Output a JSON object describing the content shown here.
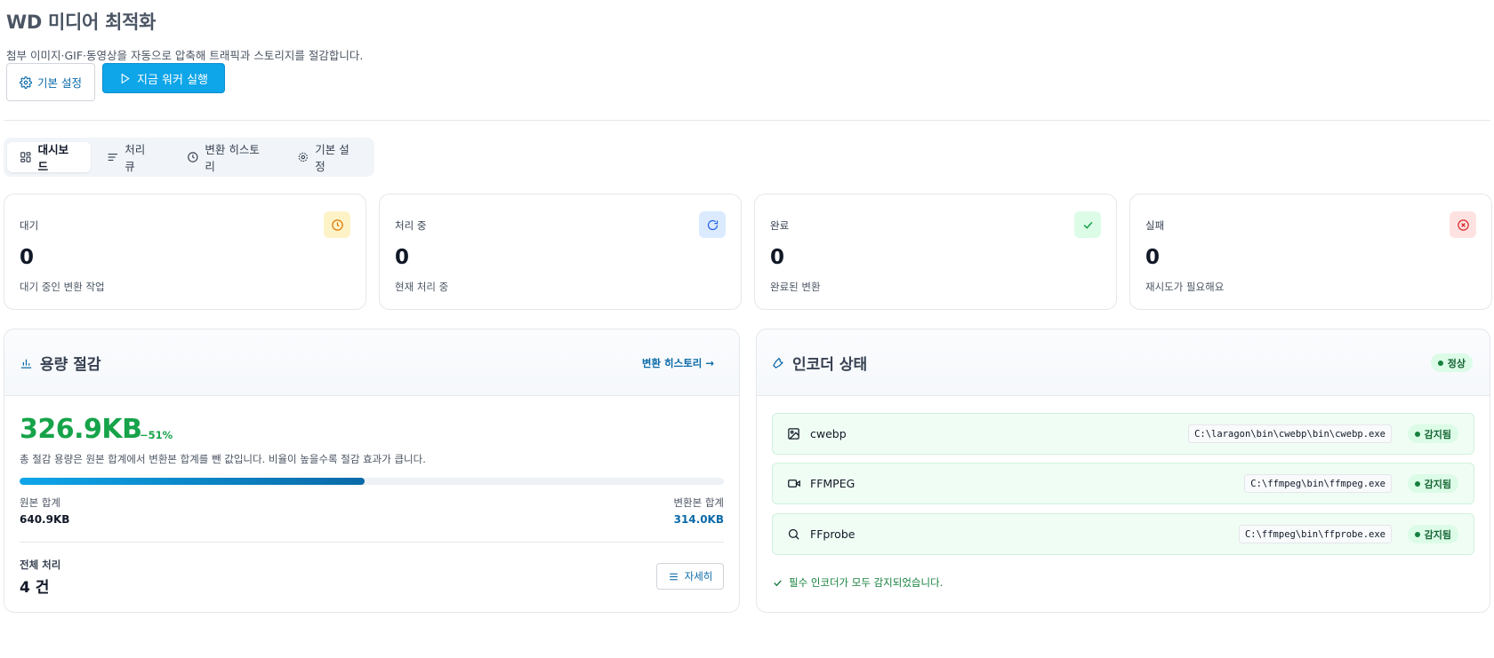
{
  "header": {
    "title": "WD 미디어 최적화",
    "description": "첨부 이미지·GIF·동영상을 자동으로 압축해 트래픽과 스토리지를 절감합니다.",
    "settings_button": "기본 설정",
    "run_button": "지금 워커 실행"
  },
  "tabs": [
    {
      "label": "대시보드",
      "icon": "grid-icon"
    },
    {
      "label": "처리 큐",
      "icon": "list-icon"
    },
    {
      "label": "변환 히스토리",
      "icon": "clock-icon"
    },
    {
      "label": "기본 설정",
      "icon": "gear-icon"
    }
  ],
  "stats": [
    {
      "label": "대기",
      "value": "0",
      "sub": "대기 중인 변환 작업",
      "icon": "clock-icon",
      "color": "#d97706",
      "bg": "#fef3c7"
    },
    {
      "label": "처리 중",
      "value": "0",
      "sub": "현재 처리 중",
      "icon": "refresh-icon",
      "color": "#2563eb",
      "bg": "#dbeafe"
    },
    {
      "label": "완료",
      "value": "0",
      "sub": "완료된 변환",
      "icon": "check-icon",
      "color": "#16a34a",
      "bg": "#dcfce7"
    },
    {
      "label": "실패",
      "value": "0",
      "sub": "재시도가 필요해요",
      "icon": "x-circle-icon",
      "color": "#dc2626",
      "bg": "#fee2e2"
    }
  ],
  "savings": {
    "title": "용량 절감",
    "history_link": "변환 히스토리 →",
    "saved": "326.9KB",
    "percent": "−51%",
    "ratio": 0.49,
    "help": "총 절감 용량은 원본 합계에서 변환본 합계를 뺀 값입니다. 비율이 높을수록 절감 효과가 큽니다.",
    "original_label": "원본 합계",
    "original_value": "640.9KB",
    "converted_label": "변환본 합계",
    "converted_value": "314.0KB",
    "total_label": "전체 처리",
    "total_value": "4 건",
    "detail_button": "자세히"
  },
  "encoders": {
    "title": "인코더 상태",
    "status": "정상",
    "items": [
      {
        "name": "cwebp",
        "path": "C:\\laragon\\bin\\cwebp\\bin\\cwebp.exe",
        "badge": "감지됨",
        "icon": "image-icon"
      },
      {
        "name": "FFMPEG",
        "path": "C:\\ffmpeg\\bin\\ffmpeg.exe",
        "badge": "감지됨",
        "icon": "video-icon"
      },
      {
        "name": "FFprobe",
        "path": "C:\\ffmpeg\\bin\\ffprobe.exe",
        "badge": "감지됨",
        "icon": "search-icon"
      }
    ],
    "message": "필수 인코더가 모두 감지되었습니다."
  }
}
